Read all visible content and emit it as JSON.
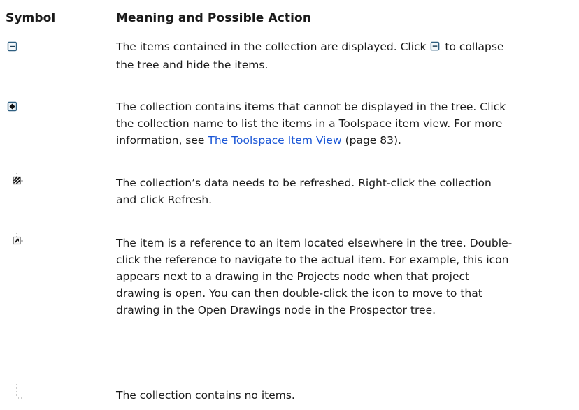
{
  "header": {
    "symbol": "Symbol",
    "meaning": "Meaning and Possible Action"
  },
  "rows": [
    {
      "icon": "collapse-minus-icon",
      "lines": [
        {
          "before": "The items contained in the collection are displayed. Click ",
          "after": " to collapse"
        },
        "the tree and hide the items."
      ]
    },
    {
      "icon": "hidden-items-icon",
      "lines": [
        "The collection contains items that cannot be displayed in the tree. Click",
        "the collection name to list the items in a Toolspace item view. For more",
        {
          "before": "information, see ",
          "link": "The Toolspace Item View",
          "after": " (page 83)."
        }
      ]
    },
    {
      "icon": "refresh-needed-icon",
      "lines": [
        "The collection’s data needs to be refreshed. Right-click the collection",
        "and click Refresh."
      ]
    },
    {
      "icon": "reference-arrow-icon",
      "lines": [
        "The item is a reference to an item located elsewhere in the tree. Double-",
        "click the reference to navigate to the actual item. For example, this icon",
        "appears next to a drawing in the Projects node when that project",
        "drawing is open. You can then double-click the icon to move to that",
        "drawing in the Open Drawings node in the Prospector tree."
      ]
    },
    {
      "icon": "empty-collection-icon",
      "lines": [
        "The collection contains no items."
      ]
    }
  ]
}
